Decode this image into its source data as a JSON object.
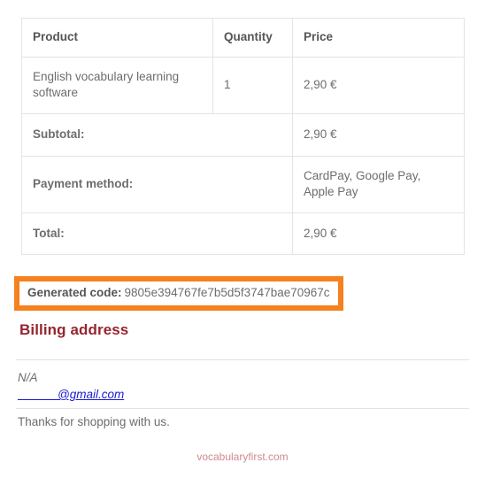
{
  "order_table": {
    "columns": [
      "Product",
      "Quantity",
      "Price"
    ],
    "items": [
      {
        "product": "English vocabulary learning software",
        "quantity": "1",
        "price": "2,90 €"
      }
    ],
    "summary": [
      {
        "label": "Subtotal:",
        "value": "2,90 €"
      },
      {
        "label": "Payment method:",
        "value": "CardPay, Google Pay, Apple Pay"
      },
      {
        "label": "Total:",
        "value": "2,90 €"
      }
    ]
  },
  "generated_code": {
    "label": "Generated code:",
    "value": "9805e394767fe7b5d5f3747bae70967c",
    "highlight_color": "#f5811f"
  },
  "billing": {
    "heading": "Billing address",
    "heading_color": "#96252f",
    "address_line": "N/A",
    "email": "            @gmail.com",
    "email_color": "#1b1bd2"
  },
  "thanks_message": "Thanks for shopping with us.",
  "footer": {
    "site": "vocabularyfirst.com",
    "color": "#cf8a90"
  }
}
